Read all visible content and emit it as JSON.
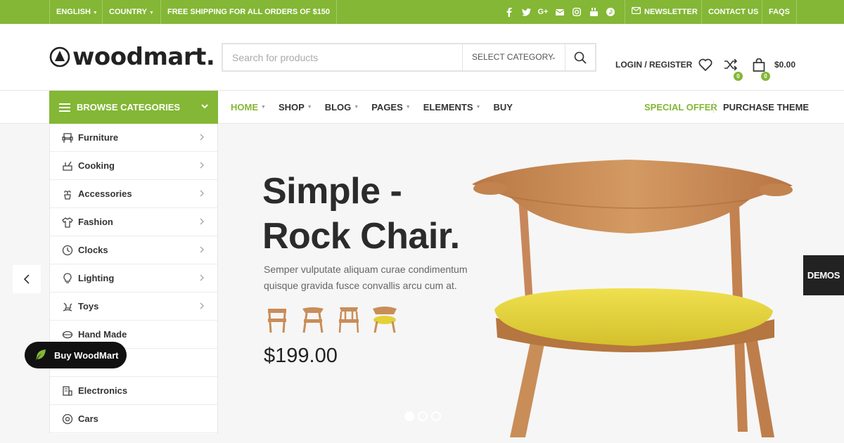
{
  "topbar": {
    "language": "ENGLISH",
    "country": "COUNTRY",
    "shipping": "FREE SHIPPING FOR ALL ORDERS OF $150",
    "newsletter": "NEWSLETTER",
    "contact": "CONTACT US",
    "faqs": "FAQS",
    "social_icons": [
      "facebook-icon",
      "twitter-icon",
      "google-plus-icon",
      "email-icon",
      "instagram-icon",
      "youtube-icon",
      "pinterest-icon"
    ]
  },
  "header": {
    "logo": "woodmart.",
    "search_placeholder": "Search for products",
    "category": "SELECT CATEGORY",
    "login": "LOGIN / REGISTER",
    "compare_count": "0",
    "cart_count": "0",
    "cart_total": "$0.00"
  },
  "nav": {
    "browse": "BROWSE CATEGORIES",
    "items": [
      "HOME",
      "SHOP",
      "BLOG",
      "PAGES",
      "ELEMENTS",
      "BUY"
    ],
    "special": "SPECIAL OFFER",
    "purchase": "PURCHASE THEME"
  },
  "categories": [
    "Furniture",
    "Cooking",
    "Accessories",
    "Fashion",
    "Clocks",
    "Lighting",
    "Toys",
    "Hand Made",
    "",
    "Electronics",
    "Cars"
  ],
  "hero": {
    "title_line1": "Simple -",
    "title_line2": "Rock Chair.",
    "subtitle": "Semper vulputate aliquam curae condimentum quisque gravida fusce convallis arcu cum at.",
    "price": "$199.00"
  },
  "demos": "DEMOS",
  "buy_button": "Buy WoodMart",
  "colors": {
    "accent": "#83b735",
    "dark": "#2b2b2b",
    "hero_bg": "#f6f6f6",
    "seat": "#e3d13a",
    "wood": "#c98d58"
  }
}
